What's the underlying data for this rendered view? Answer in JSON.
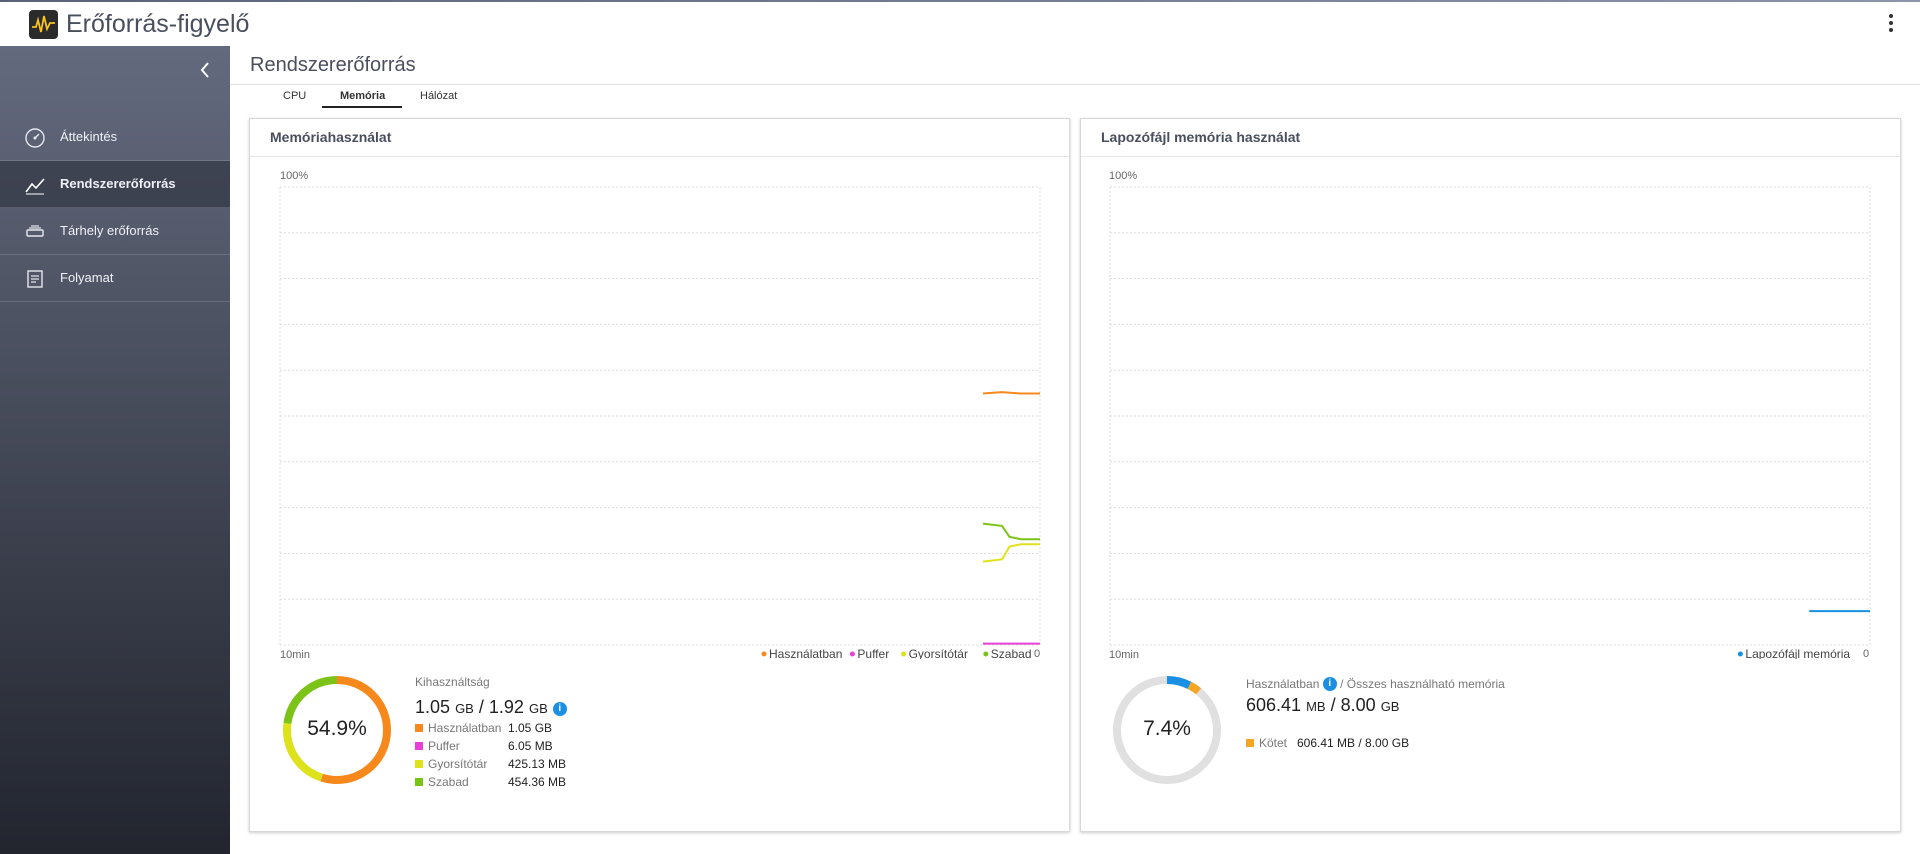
{
  "app": {
    "title": "Erőforrás-figyelő",
    "logo_icon": "activity-monitor-icon"
  },
  "sidebar": {
    "collapse_icon": "chevron-left-icon",
    "items": [
      {
        "label": "Áttekintés",
        "icon": "gauge-icon",
        "active": false
      },
      {
        "label": "Rendszererőforrás",
        "icon": "line-chart-icon",
        "active": true
      },
      {
        "label": "Tárhely erőforrás",
        "icon": "storage-icon",
        "active": false
      },
      {
        "label": "Folyamat",
        "icon": "list-document-icon",
        "active": false
      }
    ]
  },
  "main": {
    "title": "Rendszererőforrás",
    "tabs": [
      {
        "label": "CPU",
        "active": false
      },
      {
        "label": "Memória",
        "active": true
      },
      {
        "label": "Hálózat",
        "active": false
      }
    ]
  },
  "memory_panel": {
    "title": "Memóriahasználat",
    "y_top_label": "100%",
    "x_left_label": "10min",
    "x_right_label": "0",
    "legend": [
      {
        "name": "Használatban",
        "color": "#f7891c"
      },
      {
        "name": "Puffer",
        "color": "#e83fd8"
      },
      {
        "name": "Gyorsítótár",
        "color": "#dde21a"
      },
      {
        "name": "Szabad",
        "color": "#7cc318"
      }
    ],
    "usage_label": "Kihasználtság",
    "usage_used": "1.05",
    "usage_total": "1.92",
    "usage_unit": "GB",
    "usage_sep": "/",
    "donut_percent": "54.9%",
    "breakdown": [
      {
        "label": "Használatban",
        "value": "1.05 GB",
        "color": "#f7891c"
      },
      {
        "label": "Puffer",
        "value": "6.05 MB",
        "color": "#e83fd8"
      },
      {
        "label": "Gyorsítótár",
        "value": "425.13 MB",
        "color": "#dde21a"
      },
      {
        "label": "Szabad",
        "value": "454.36 MB",
        "color": "#7cc318"
      }
    ]
  },
  "swap_panel": {
    "title": "Lapozófájl memória használat",
    "y_top_label": "100%",
    "x_left_label": "10min",
    "x_right_label": "0",
    "legend": [
      {
        "name": "Lapozófájl memória",
        "color": "#1a8fe3"
      }
    ],
    "usage_label_a": "Használatban",
    "usage_label_b": "/ Összes használható memória",
    "usage_used": "606.41",
    "usage_used_unit": "MB",
    "usage_total": "8.00",
    "usage_total_unit": "GB",
    "usage_sep": "/",
    "donut_percent": "7.4%",
    "breakdown": [
      {
        "label": "Kötet",
        "value": "606.41 MB / 8.00 GB",
        "color": "#f5a623"
      }
    ]
  },
  "chart_data": [
    {
      "type": "line",
      "title": "Memóriahasználat",
      "ylim": [
        0,
        100
      ],
      "x_range_minutes": [
        10,
        0
      ],
      "grid": true,
      "legend_position": "bottom-right",
      "series": [
        {
          "name": "Használatban",
          "color": "#f7891c",
          "x": [
            0.75,
            0.5,
            0.25,
            0
          ],
          "y": [
            54.9,
            55.2,
            54.9,
            54.9
          ]
        },
        {
          "name": "Puffer",
          "color": "#e83fd8",
          "x": [
            0.75,
            0
          ],
          "y": [
            0.3,
            0.3
          ]
        },
        {
          "name": "Gyorsítótár",
          "color": "#dde21a",
          "x": [
            0.75,
            0.5,
            0.4,
            0.25,
            0
          ],
          "y": [
            18.2,
            18.7,
            21.5,
            22.0,
            22.0
          ]
        },
        {
          "name": "Szabad",
          "color": "#7cc318",
          "x": [
            0.75,
            0.5,
            0.4,
            0.25,
            0
          ],
          "y": [
            26.5,
            26.0,
            23.6,
            23.1,
            23.1
          ]
        }
      ]
    },
    {
      "type": "line",
      "title": "Lapozófájl memória használat",
      "ylim": [
        0,
        100
      ],
      "x_range_minutes": [
        10,
        0
      ],
      "grid": true,
      "legend_position": "bottom-right",
      "series": [
        {
          "name": "Lapozófájl memória",
          "color": "#1a8fe3",
          "x": [
            0.8,
            0
          ],
          "y": [
            7.4,
            7.4
          ]
        }
      ]
    },
    {
      "type": "pie",
      "title": "",
      "categories": [
        "Használatban",
        "Gyorsítótár",
        "Szabad"
      ],
      "values": [
        54.9,
        22.1,
        23.0
      ],
      "colors": [
        "#f7891c",
        "#dde21a",
        "#7cc318"
      ]
    },
    {
      "type": "pie",
      "title": "",
      "categories": [
        "Használatban",
        "Kötet"
      ],
      "values": [
        7.4,
        3.5
      ],
      "colors": [
        "#1a8fe3",
        "#f5a623"
      ]
    }
  ]
}
